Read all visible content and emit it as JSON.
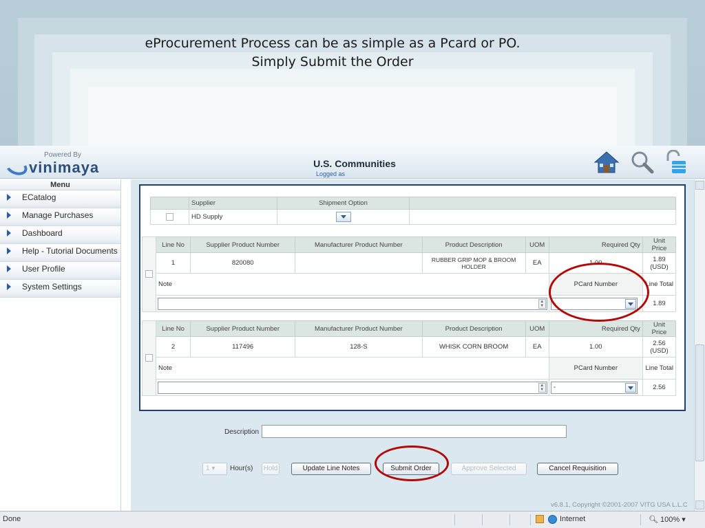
{
  "slide": {
    "caption_line1": "eProcurement Process can be as simple as a Pcard or PO.",
    "caption_line2": "Simply Submit the Order"
  },
  "header": {
    "logo_powered": "Powered By",
    "logo_name": "vinimaya",
    "title": "U.S. Communities",
    "logged_as": "Logged as",
    "icons": [
      "home-icon",
      "search-icon",
      "lock-icon"
    ]
  },
  "menu": {
    "title": "Menu",
    "items": [
      "ECatalog",
      "Manage Purchases",
      "Dashboard",
      "Help - Tutorial Documents",
      "User Profile",
      "System Settings"
    ]
  },
  "supplier_table": {
    "headers": [
      "Supplier",
      "Shipment Option"
    ],
    "supplier": "HD Supply"
  },
  "line_items": {
    "headers": [
      "Line No",
      "Supplier Product Number",
      "Manufacturer Product Number",
      "Product Description",
      "UOM",
      "Required Qty",
      "Unit Price"
    ],
    "note_label": "Note",
    "pcard_label": "PCard Number",
    "line_total_label": "Line Total",
    "rows": [
      {
        "line_no": "1",
        "supplier_pn": "820080",
        "manufacturer_pn": "",
        "description": "RUBBER GRIP MOP & BROOM HOLDER",
        "uom": "EA",
        "qty": "1.00",
        "unit_price": "1.89 (USD)",
        "pcard": "-",
        "line_total": "1.89"
      },
      {
        "line_no": "2",
        "supplier_pn": "117496",
        "manufacturer_pn": "128-S",
        "description": "WHISK CORN BROOM",
        "uom": "EA",
        "qty": "1.00",
        "unit_price": "2.56 (USD)",
        "pcard": "-",
        "line_total": "2.56"
      }
    ]
  },
  "form": {
    "description_label": "Description",
    "hours_value": "1",
    "hours_label": "Hour(s)",
    "hold_label": "Hold",
    "update_notes": "Update Line Notes",
    "submit_order": "Submit Order",
    "approve_selected": "Approve Selected",
    "cancel_requisition": "Cancel Requisition"
  },
  "copyright": "v6.8.1, Copyright ©2001-2007 VITG USA L.L.C",
  "statusbar": {
    "left": "Done",
    "zone": "Internet",
    "zoom": "100%"
  },
  "colors": {
    "annotation_circle": "#b00b0b",
    "content_border": "#1f3f73",
    "header_bg": "#dbe6e2"
  }
}
